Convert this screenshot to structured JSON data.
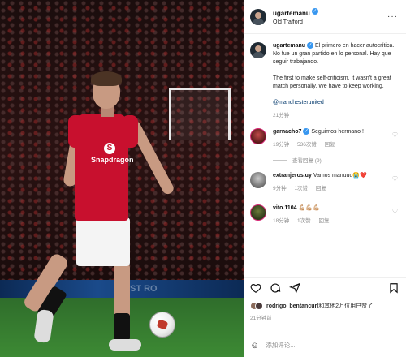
{
  "post": {
    "username": "ugartemanu",
    "location": "Old Trafford",
    "more_icon": "more-horizontal-icon",
    "caption": {
      "username": "ugartemanu",
      "text_es": "El primero en hacer autocrítica. No fue un gran partido en lo personal. Hay que seguir trabajando.",
      "text_en": "The first to make self-criticism. It wasn't a great match personally. We have to keep working.",
      "tag": "@manchesterunited",
      "time": "21分钟"
    },
    "photo": {
      "shirt_sponsor": "Snapdragon",
      "board_text": "ST RO"
    }
  },
  "comments": [
    {
      "username": "garnacho7",
      "text": "Seguimos hermano !",
      "time": "19分钟",
      "likes": "536次赞",
      "reply": "回复",
      "replies": "查看回复 (9)"
    },
    {
      "username": "extranjeros.uy",
      "text": "Vamos manuuu😭❤️",
      "time": "9分钟",
      "likes": "1次赞",
      "reply": "回复"
    },
    {
      "username": "vito.1104",
      "text": "💪🏼💪🏼💪🏼",
      "time": "18分钟",
      "likes": "1次赞",
      "reply": "回复"
    }
  ],
  "actions": {
    "like_icon": "heart-icon",
    "comment_icon": "comment-icon",
    "share_icon": "share-icon",
    "save_icon": "bookmark-icon"
  },
  "likes_line": {
    "username": "rodrigo_bentancurl",
    "text": "和其他2万位用户赞了"
  },
  "post_time": "21分钟前",
  "add_comment": {
    "placeholder": "添加评论..."
  },
  "colors": {
    "accent_blue": "#3897f0",
    "man_utd_red": "#c8102e",
    "link_blue": "#00376b"
  }
}
